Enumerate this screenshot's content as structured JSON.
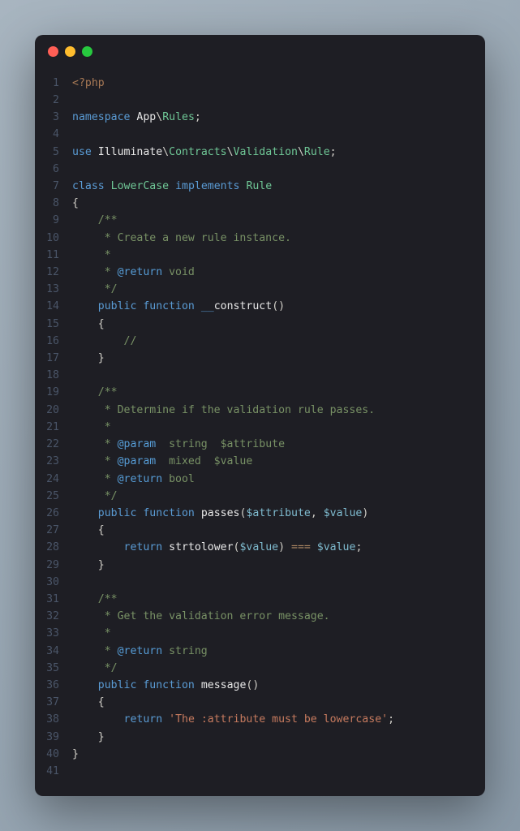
{
  "titlebar": {
    "dots": [
      "red",
      "yellow",
      "green"
    ]
  },
  "code": {
    "lines": [
      {
        "n": "1",
        "tokens": [
          {
            "c": "tag",
            "t": "<?php"
          }
        ]
      },
      {
        "n": "2",
        "tokens": []
      },
      {
        "n": "3",
        "tokens": [
          {
            "c": "kw",
            "t": "namespace"
          },
          {
            "c": "ns",
            "t": " App"
          },
          {
            "c": "punct",
            "t": "\\"
          },
          {
            "c": "cls",
            "t": "Rules"
          },
          {
            "c": "punct",
            "t": ";"
          }
        ]
      },
      {
        "n": "4",
        "tokens": []
      },
      {
        "n": "5",
        "tokens": [
          {
            "c": "kw",
            "t": "use"
          },
          {
            "c": "ns",
            "t": " Illuminate"
          },
          {
            "c": "punct",
            "t": "\\"
          },
          {
            "c": "cls",
            "t": "Contracts"
          },
          {
            "c": "punct",
            "t": "\\"
          },
          {
            "c": "cls",
            "t": "Validation"
          },
          {
            "c": "punct",
            "t": "\\"
          },
          {
            "c": "cls",
            "t": "Rule"
          },
          {
            "c": "punct",
            "t": ";"
          }
        ]
      },
      {
        "n": "6",
        "tokens": []
      },
      {
        "n": "7",
        "tokens": [
          {
            "c": "kw",
            "t": "class"
          },
          {
            "c": "ns",
            "t": " "
          },
          {
            "c": "cls",
            "t": "LowerCase"
          },
          {
            "c": "ns",
            "t": " "
          },
          {
            "c": "kw",
            "t": "implements"
          },
          {
            "c": "ns",
            "t": " "
          },
          {
            "c": "cls",
            "t": "Rule"
          }
        ]
      },
      {
        "n": "8",
        "tokens": [
          {
            "c": "punct",
            "t": "{"
          }
        ]
      },
      {
        "n": "9",
        "tokens": [
          {
            "c": "comment",
            "t": "    /**"
          }
        ]
      },
      {
        "n": "10",
        "tokens": [
          {
            "c": "comment",
            "t": "     * Create a new rule instance."
          }
        ]
      },
      {
        "n": "11",
        "tokens": [
          {
            "c": "comment",
            "t": "     *"
          }
        ]
      },
      {
        "n": "12",
        "tokens": [
          {
            "c": "comment",
            "t": "     * "
          },
          {
            "c": "doctag",
            "t": "@return"
          },
          {
            "c": "comment",
            "t": " void"
          }
        ]
      },
      {
        "n": "13",
        "tokens": [
          {
            "c": "comment",
            "t": "     */"
          }
        ]
      },
      {
        "n": "14",
        "tokens": [
          {
            "c": "ns",
            "t": "    "
          },
          {
            "c": "kw",
            "t": "public"
          },
          {
            "c": "ns",
            "t": " "
          },
          {
            "c": "kw",
            "t": "function"
          },
          {
            "c": "ns",
            "t": " "
          },
          {
            "c": "kw",
            "t": "__"
          },
          {
            "c": "fn",
            "t": "construct"
          },
          {
            "c": "punct",
            "t": "()"
          }
        ]
      },
      {
        "n": "15",
        "tokens": [
          {
            "c": "punct",
            "t": "    {"
          }
        ]
      },
      {
        "n": "16",
        "tokens": [
          {
            "c": "comment",
            "t": "        //"
          }
        ]
      },
      {
        "n": "17",
        "tokens": [
          {
            "c": "punct",
            "t": "    }"
          }
        ]
      },
      {
        "n": "18",
        "tokens": []
      },
      {
        "n": "19",
        "tokens": [
          {
            "c": "comment",
            "t": "    /**"
          }
        ]
      },
      {
        "n": "20",
        "tokens": [
          {
            "c": "comment",
            "t": "     * Determine if the validation rule passes."
          }
        ]
      },
      {
        "n": "21",
        "tokens": [
          {
            "c": "comment",
            "t": "     *"
          }
        ]
      },
      {
        "n": "22",
        "tokens": [
          {
            "c": "comment",
            "t": "     * "
          },
          {
            "c": "doctag",
            "t": "@param"
          },
          {
            "c": "comment",
            "t": "  string  $attribute"
          }
        ]
      },
      {
        "n": "23",
        "tokens": [
          {
            "c": "comment",
            "t": "     * "
          },
          {
            "c": "doctag",
            "t": "@param"
          },
          {
            "c": "comment",
            "t": "  mixed  $value"
          }
        ]
      },
      {
        "n": "24",
        "tokens": [
          {
            "c": "comment",
            "t": "     * "
          },
          {
            "c": "doctag",
            "t": "@return"
          },
          {
            "c": "comment",
            "t": " bool"
          }
        ]
      },
      {
        "n": "25",
        "tokens": [
          {
            "c": "comment",
            "t": "     */"
          }
        ]
      },
      {
        "n": "26",
        "tokens": [
          {
            "c": "ns",
            "t": "    "
          },
          {
            "c": "kw",
            "t": "public"
          },
          {
            "c": "ns",
            "t": " "
          },
          {
            "c": "kw",
            "t": "function"
          },
          {
            "c": "ns",
            "t": " "
          },
          {
            "c": "fn",
            "t": "passes"
          },
          {
            "c": "punct",
            "t": "("
          },
          {
            "c": "var",
            "t": "$attribute"
          },
          {
            "c": "punct",
            "t": ", "
          },
          {
            "c": "var",
            "t": "$value"
          },
          {
            "c": "punct",
            "t": ")"
          }
        ]
      },
      {
        "n": "27",
        "tokens": [
          {
            "c": "punct",
            "t": "    {"
          }
        ]
      },
      {
        "n": "28",
        "tokens": [
          {
            "c": "ns",
            "t": "        "
          },
          {
            "c": "kw",
            "t": "return"
          },
          {
            "c": "ns",
            "t": " "
          },
          {
            "c": "fn",
            "t": "strtolower"
          },
          {
            "c": "punct",
            "t": "("
          },
          {
            "c": "var",
            "t": "$value"
          },
          {
            "c": "punct",
            "t": ") "
          },
          {
            "c": "op",
            "t": "==="
          },
          {
            "c": "punct",
            "t": " "
          },
          {
            "c": "var",
            "t": "$value"
          },
          {
            "c": "punct",
            "t": ";"
          }
        ]
      },
      {
        "n": "29",
        "tokens": [
          {
            "c": "punct",
            "t": "    }"
          }
        ]
      },
      {
        "n": "30",
        "tokens": []
      },
      {
        "n": "31",
        "tokens": [
          {
            "c": "comment",
            "t": "    /**"
          }
        ]
      },
      {
        "n": "32",
        "tokens": [
          {
            "c": "comment",
            "t": "     * Get the validation error message."
          }
        ]
      },
      {
        "n": "33",
        "tokens": [
          {
            "c": "comment",
            "t": "     *"
          }
        ]
      },
      {
        "n": "34",
        "tokens": [
          {
            "c": "comment",
            "t": "     * "
          },
          {
            "c": "doctag",
            "t": "@return"
          },
          {
            "c": "comment",
            "t": " string"
          }
        ]
      },
      {
        "n": "35",
        "tokens": [
          {
            "c": "comment",
            "t": "     */"
          }
        ]
      },
      {
        "n": "36",
        "tokens": [
          {
            "c": "ns",
            "t": "    "
          },
          {
            "c": "kw",
            "t": "public"
          },
          {
            "c": "ns",
            "t": " "
          },
          {
            "c": "kw",
            "t": "function"
          },
          {
            "c": "ns",
            "t": " "
          },
          {
            "c": "fn",
            "t": "message"
          },
          {
            "c": "punct",
            "t": "()"
          }
        ]
      },
      {
        "n": "37",
        "tokens": [
          {
            "c": "punct",
            "t": "    {"
          }
        ]
      },
      {
        "n": "38",
        "tokens": [
          {
            "c": "ns",
            "t": "        "
          },
          {
            "c": "kw",
            "t": "return"
          },
          {
            "c": "ns",
            "t": " "
          },
          {
            "c": "str",
            "t": "'The :attribute must be lowercase'"
          },
          {
            "c": "punct",
            "t": ";"
          }
        ]
      },
      {
        "n": "39",
        "tokens": [
          {
            "c": "punct",
            "t": "    }"
          }
        ]
      },
      {
        "n": "40",
        "tokens": [
          {
            "c": "punct",
            "t": "}"
          }
        ]
      },
      {
        "n": "41",
        "tokens": []
      }
    ]
  }
}
